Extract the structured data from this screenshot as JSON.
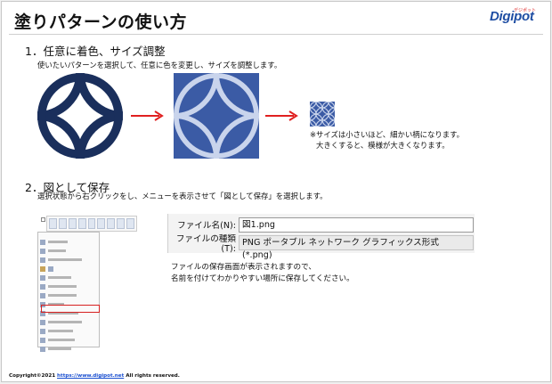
{
  "page": {
    "title": "塗りパターンの使い方",
    "logo_text": "Digipot",
    "logo_kana": "デジポット"
  },
  "section1": {
    "heading": "1．任意に着色、サイズ調整",
    "desc": "使いたいパターンを選択して、任意に色を変更し、サイズを調整します。",
    "note_line1": "※サイズは小さいほど、細かい柄になります。",
    "note_line2": "大きくすると、模様が大きくなります。",
    "colors": {
      "pattern_dark": "#1a2f5c",
      "pattern_blue": "#3b5ba5",
      "pattern_light": "#ffffff",
      "arrow": "#e02020"
    }
  },
  "section2": {
    "heading": "2．図として保存",
    "desc": "選択状態から右クリックをし、メニューを表示させて「図として保存」を選択します。",
    "dialog": {
      "filename_label": "ファイル名(N):",
      "filename_value": "図1.png",
      "filetype_label": "ファイルの種類(T):",
      "filetype_value": "PNG ポータブル ネットワーク グラフィックス形式 (*.png)"
    },
    "note_line1": "ファイルの保存画面が表示されますので、",
    "note_line2": "名前を付けてわかりやすい場所に保存してください。"
  },
  "footer": {
    "prefix": "Copyright©2021 ",
    "link": "https://www.digipot.net",
    "suffix": " All rights reserved."
  }
}
